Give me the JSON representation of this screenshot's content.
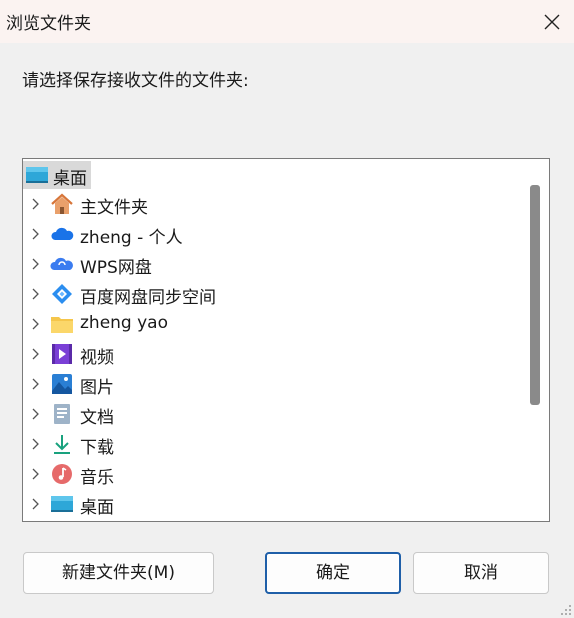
{
  "dialog": {
    "title": "浏览文件夹",
    "prompt": "请选择保存接收文件的文件夹:"
  },
  "tree": {
    "root": {
      "label": "桌面",
      "icon": "desktop-icon"
    },
    "items": [
      {
        "label": "主文件夹",
        "icon": "home-icon"
      },
      {
        "label": "zheng - 个人",
        "icon": "onedrive-cloud-icon"
      },
      {
        "label": "WPS网盘",
        "icon": "wps-cloud-icon"
      },
      {
        "label": "百度网盘同步空间",
        "icon": "baidu-netdisk-icon"
      },
      {
        "label": "zheng yao",
        "icon": "folder-icon"
      },
      {
        "label": "视频",
        "icon": "video-icon"
      },
      {
        "label": "图片",
        "icon": "pictures-icon"
      },
      {
        "label": "文档",
        "icon": "documents-icon"
      },
      {
        "label": "下载",
        "icon": "download-icon"
      },
      {
        "label": "音乐",
        "icon": "music-icon"
      },
      {
        "label": "桌面",
        "icon": "desktop-icon"
      }
    ]
  },
  "buttons": {
    "new_folder": "新建文件夹(M)",
    "ok": "确定",
    "cancel": "取消"
  },
  "colors": {
    "titlebar": "#fbf3f1",
    "dialog_bg": "#f0f0f0",
    "primary_border": "#1f5fa8",
    "selection": "#d9d9d9"
  }
}
